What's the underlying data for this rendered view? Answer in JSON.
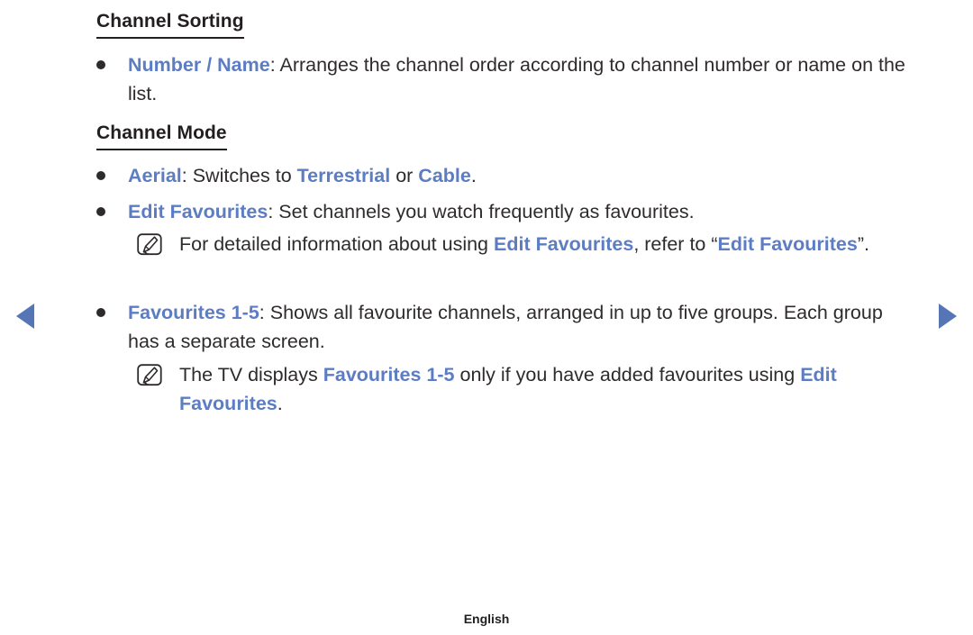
{
  "accent_color": "#5c7cc4",
  "arrow_color": "#5575b5",
  "text_color": "#2f2b2c",
  "sections": [
    {
      "heading": "Channel Sorting",
      "bullets": [
        {
          "term": "Number / Name",
          "separator": ": ",
          "body": "Arranges the channel order according to channel number or name on the list."
        }
      ]
    },
    {
      "heading": "Channel Mode",
      "bullets": [
        {
          "term": "Aerial",
          "separator": ": ",
          "body_part1": "Switches to ",
          "inline_term1": "Terrestrial",
          "body_part2": " or ",
          "inline_term2": "Cable",
          "body_part3": "."
        },
        {
          "term": "Edit Favourites",
          "separator": ": ",
          "body": "Set channels you watch frequently as favourites."
        },
        {
          "term": "Favourites 1-5",
          "separator": ": ",
          "body": "Shows all favourite channels, arranged in up to five groups. Each group has a separate screen."
        }
      ]
    }
  ],
  "notes": [
    {
      "icon": "note-pen-icon",
      "part1": "For detailed information about using ",
      "term1": "Edit Favourites",
      "part2": ", refer to “",
      "term2": "Edit Favourites",
      "part3": "”."
    },
    {
      "icon": "note-pen-icon",
      "part1": "The TV displays ",
      "term1": "Favourites 1-5",
      "part2": " only if you have added favourites using ",
      "term2": "Edit Favourites",
      "part3": "."
    }
  ],
  "navigation": {
    "prev_label": "previous-page",
    "next_label": "next-page"
  },
  "footer": {
    "language": "English"
  }
}
